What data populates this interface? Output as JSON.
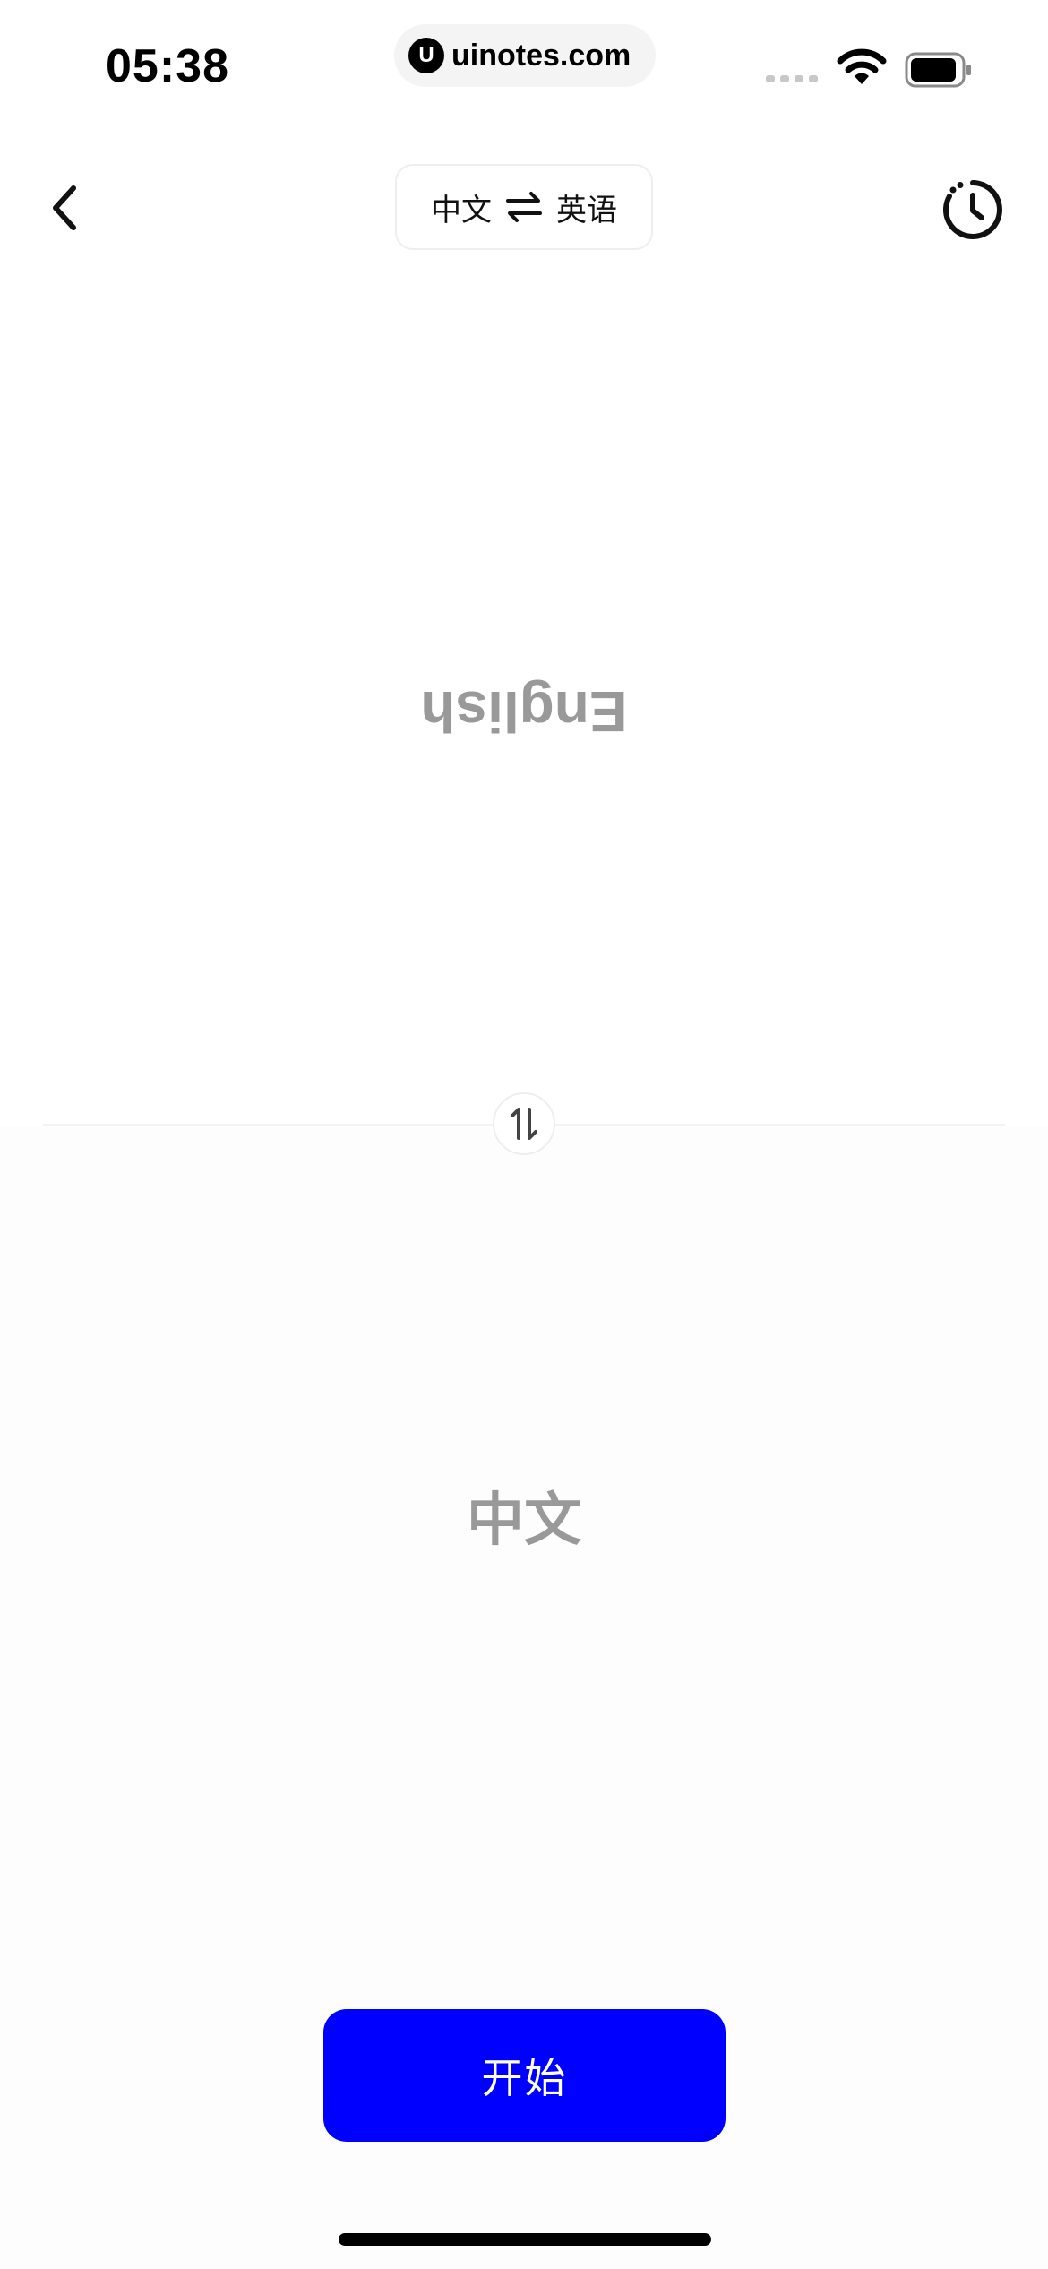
{
  "status_bar": {
    "time": "05:38",
    "url": "uinotes.com",
    "url_logo_letter": "U",
    "icons": [
      "signal-dots-icon",
      "wifi-icon",
      "battery-icon"
    ]
  },
  "nav": {
    "back_icon": "chevron-left-icon",
    "source_language": "中文",
    "swap_icon": "swap-arrows-icon",
    "target_language": "英语",
    "history_icon": "history-clock-icon"
  },
  "panes": {
    "target_text": "English",
    "source_text": "中文",
    "swap_orientation_icon": "swap-vertical-icon"
  },
  "actions": {
    "start_label": "开始"
  },
  "colors": {
    "accent": "#0000ff",
    "placeholder_text": "#999999",
    "divider": "#f2f2f2"
  }
}
